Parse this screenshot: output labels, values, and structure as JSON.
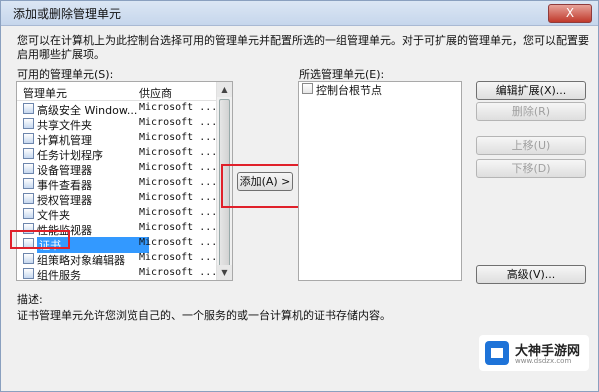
{
  "window": {
    "title": "添加或删除管理单元",
    "close_label": "X"
  },
  "description": "您可以在计算机上为此控制台选择可用的管理单元并配置所选的一组管理单元。对于可扩展的管理单元，您可以配置要启用哪些扩展项。",
  "available": {
    "label": "可用的管理单元(S):",
    "col_name": "管理单元",
    "col_vendor": "供应商",
    "items": [
      {
        "name": "高级安全 Window...",
        "vendor": "Microsoft ..."
      },
      {
        "name": "共享文件夹",
        "vendor": "Microsoft ..."
      },
      {
        "name": "计算机管理",
        "vendor": "Microsoft ..."
      },
      {
        "name": "任务计划程序",
        "vendor": "Microsoft ..."
      },
      {
        "name": "设备管理器",
        "vendor": "Microsoft ..."
      },
      {
        "name": "事件查看器",
        "vendor": "Microsoft ..."
      },
      {
        "name": "授权管理器",
        "vendor": "Microsoft ..."
      },
      {
        "name": "文件夹",
        "vendor": "Microsoft ..."
      },
      {
        "name": "性能监视器",
        "vendor": "Microsoft ..."
      },
      {
        "name": "证书",
        "vendor": "Microsoft ..."
      },
      {
        "name": "组策略对象编辑器",
        "vendor": "Microsoft ..."
      },
      {
        "name": "组件服务",
        "vendor": "Microsoft ..."
      }
    ],
    "selected_index": 9
  },
  "add_button": "添加(A) >",
  "selected": {
    "label": "所选管理单元(E):",
    "items": [
      "控制台根节点"
    ]
  },
  "buttons": {
    "edit_ext": "编辑扩展(X)...",
    "delete": "删除(R)",
    "up": "上移(U)",
    "down": "下移(D)",
    "advanced": "高级(V)..."
  },
  "desc_label": "描述:",
  "desc_text": "证书管理单元允许您浏览自己的、一个服务的或一台计算机的证书存储内容。",
  "watermark": {
    "title": "大神手游网",
    "url": "www.dsdzx.com"
  },
  "colors": {
    "selection": "#3399ff",
    "highlight_box": "#e0202a"
  }
}
